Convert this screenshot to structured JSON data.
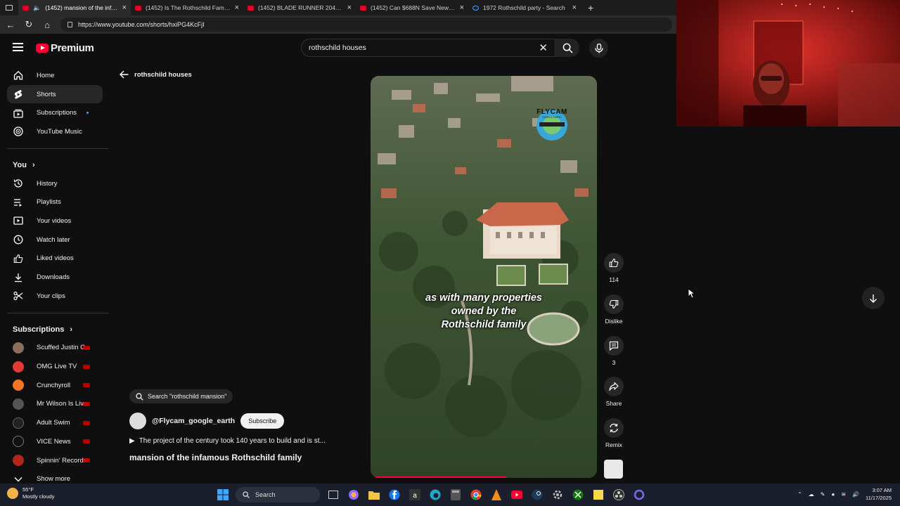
{
  "browser": {
    "tabs": [
      {
        "title": "(1452) mansion of the infam",
        "active": true,
        "muted": true
      },
      {
        "title": "(1452) Is The Rothschild Family Th",
        "active": false
      },
      {
        "title": "(1452) BLADE RUNNER 2049 Brea",
        "active": false
      },
      {
        "title": "(1452) Can $688N Save New York",
        "active": false
      },
      {
        "title": "1972 Rothschild party - Search",
        "active": false,
        "bing": true
      }
    ],
    "url": "https://www.youtube.com/shorts/hxiPG4KcFjI"
  },
  "youtube": {
    "logo_text": "Premium",
    "search_value": "rothschild houses",
    "sidebar": {
      "main": [
        {
          "label": "Home",
          "icon": "home-icon"
        },
        {
          "label": "Shorts",
          "icon": "shorts-icon",
          "active": true
        },
        {
          "label": "Subscriptions",
          "icon": "subscriptions-icon",
          "dot": true
        },
        {
          "label": "YouTube Music",
          "icon": "music-icon"
        }
      ],
      "you_header": "You",
      "you": [
        {
          "label": "History",
          "icon": "history-icon"
        },
        {
          "label": "Playlists",
          "icon": "playlists-icon"
        },
        {
          "label": "Your videos",
          "icon": "your-videos-icon"
        },
        {
          "label": "Watch later",
          "icon": "clock-icon"
        },
        {
          "label": "Liked videos",
          "icon": "thumbs-up-icon"
        },
        {
          "label": "Downloads",
          "icon": "download-icon"
        },
        {
          "label": "Your clips",
          "icon": "scissors-icon"
        }
      ],
      "subs_header": "Subscriptions",
      "subscriptions": [
        {
          "label": "Scuffed Justin C...",
          "color": "#8a6d5a"
        },
        {
          "label": "OMG Live TV",
          "color": "#e53935"
        },
        {
          "label": "Crunchyroll",
          "color": "#f47521"
        },
        {
          "label": "Mr Wilson Is Live",
          "color": "#555555"
        },
        {
          "label": "Adult Swim",
          "color": "#222222"
        },
        {
          "label": "VICE News",
          "color": "#111111"
        },
        {
          "label": "Spinnin' Records",
          "color": "#b3261e"
        }
      ],
      "show_more": "Show more"
    },
    "back_label": "rothschild houses",
    "short": {
      "caption_lines": [
        "as with many properties",
        "owned by the",
        "Rothschild family"
      ],
      "overlay_logo": "FLYCAM",
      "overlay_logo_sub": "GOOGLE EARTH",
      "progress": 0.6
    },
    "actions": {
      "likes": "114",
      "dislike": "Dislike",
      "comments": "3",
      "share": "Share",
      "remix": "Remix"
    },
    "meta": {
      "search_chip": "Search \"rothschild mansion\"",
      "channel": "@Flycam_google_earth",
      "subscribe": "Subscribe",
      "description": "The project of the century took 140 years to build and is st...",
      "title": "mansion of the infamous Rothschild family"
    }
  },
  "taskbar": {
    "temperature": "55°F",
    "weather": "Mostly cloudy",
    "search": "Search",
    "time": "3:07 AM",
    "date": "11/17/2025"
  }
}
